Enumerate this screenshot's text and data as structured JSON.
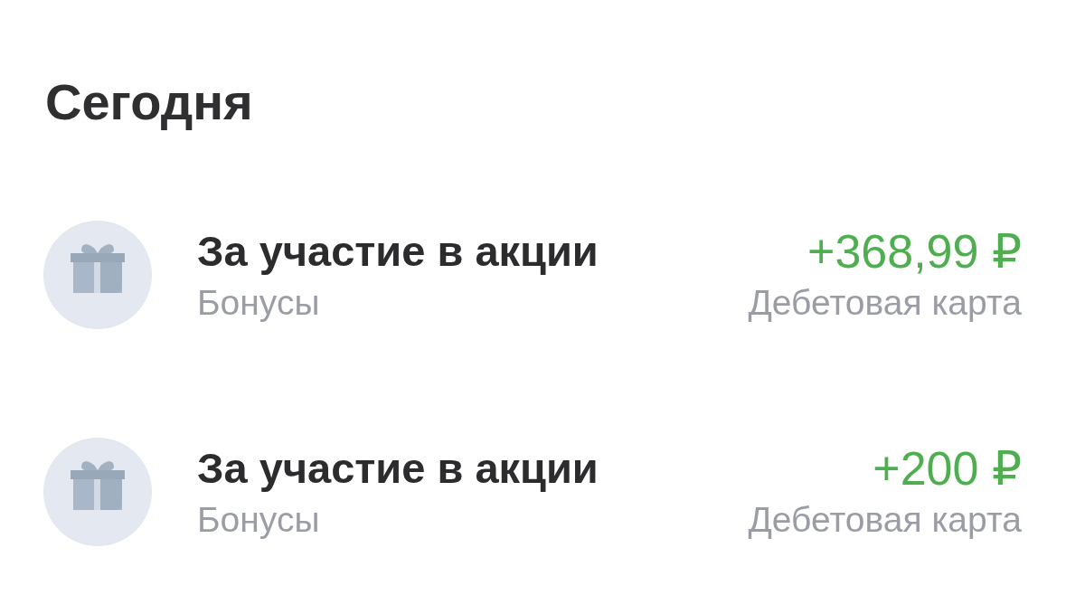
{
  "section": {
    "title": "Сегодня"
  },
  "transactions": [
    {
      "title": "За участие в акции",
      "category": "Бонусы",
      "amount": "+368,99 ₽",
      "account": "Дебетовая карта",
      "kind": "income"
    },
    {
      "title": "За участие в акции",
      "category": "Бонусы",
      "amount": "+200 ₽",
      "account": "Дебетовая карта",
      "kind": "income"
    }
  ]
}
